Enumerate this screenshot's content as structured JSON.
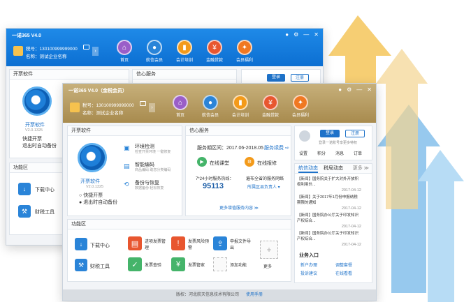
{
  "back": {
    "title": "一诺365 V4.0",
    "tax_label": "税号：130100999999000",
    "name_label": "名称：测试企业名称",
    "controls": [
      "●",
      "⚙",
      "—",
      "✕"
    ],
    "nav": [
      "首页",
      "航信会员",
      "会计培训",
      "金融贷款",
      "会员福利"
    ],
    "invoice_heading": "开票软件",
    "service_heading": "信心服务",
    "app_name": "开票软件",
    "version": "V2.0.1325",
    "quick": "快捷开票",
    "auto": "退出时自动备份",
    "func_heading": "功能区",
    "download": "下载中心",
    "tax_tool": "财税工具",
    "login": "登录",
    "register": "注册"
  },
  "front": {
    "title": "一诺365 V4.0（金税会员）",
    "tax_label": "税号：130100999999000",
    "name_label": "名称：测试企业名称",
    "controls": [
      "●",
      "⚙",
      "—",
      "✕"
    ],
    "nav": [
      "首页",
      "航信会员",
      "会计培训",
      "金融贷款",
      "会员福利"
    ],
    "invoice_panel": {
      "heading": "开票软件",
      "app_name": "开票软件",
      "version": "V2.0.1325",
      "quick": "快捷开票",
      "auto": "退出时自动备份",
      "side": [
        {
          "title": "环境检测",
          "desc": "检查开票环境 一键修复"
        },
        {
          "title": "智能编码",
          "desc": "商品编码 助您分类编码"
        },
        {
          "title": "备份与恢复",
          "desc": "数据备份 轻松恢复"
        }
      ]
    },
    "service_panel": {
      "heading": "信心服务",
      "period": "服务期区间：2017.06-2018.05",
      "renew": "服务续费 ⇨",
      "online": "在线课堂",
      "repair": "在线报修",
      "hotline_label": "7*24小时服务热线：",
      "hotline": "95113",
      "network": "遍布全省的服务网络",
      "contact": "所属区县负责人 ▾",
      "more": "更多增值服务内容 ≫"
    },
    "user_panel": {
      "login": "登录",
      "register": "注册",
      "hint": "登录一诺账号享更多特权",
      "links": [
        "设置",
        "积分",
        "消息",
        "订单"
      ]
    },
    "news_panel": {
      "tabs": [
        "航信动态",
        "税局动态"
      ],
      "more": "更多 ≫",
      "items": [
        {
          "text": "【新闻】国务院关于扩大对外开放积极利用外...",
          "date": "2017-04-12"
        },
        {
          "text": "【新闻】关于2017年1月份申报纳税期限的通知",
          "date": "2017-04-12"
        },
        {
          "text": "【新闻】国务院办公厅关于印发知识产权综合...",
          "date": "2017-04-12"
        },
        {
          "text": "【新闻】国务院办公厅关于印发知识产权综合...",
          "date": "2017-04-12"
        }
      ],
      "business_heading": "业务入口",
      "business": [
        "新户办理",
        "调整套餐",
        "投诉建议",
        "在线看看"
      ]
    },
    "func_panel": {
      "heading": "功能区",
      "items": [
        "下载中心",
        "财税工具",
        "进项发票管理",
        "发票查验",
        "发票风险预警",
        "发票管家",
        "申报文件导出",
        "添加功能"
      ],
      "more": "更多"
    },
    "footer": "版权：河北航天信息技术有限公司",
    "footer_link": "使用手册"
  }
}
